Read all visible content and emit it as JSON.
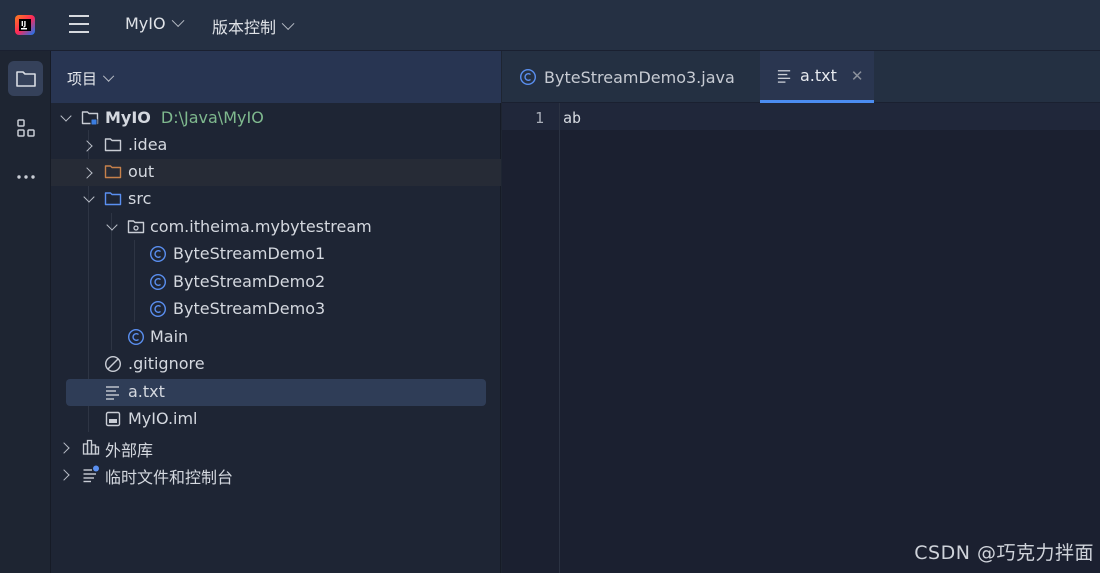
{
  "topbar": {
    "menus": [
      {
        "label": "MyIO"
      },
      {
        "label": "版本控制"
      }
    ]
  },
  "toolstrip": {
    "tools": [
      "folder-icon",
      "structure-icon",
      "more-icon"
    ]
  },
  "project_panel": {
    "title": "项目",
    "tree": [
      {
        "label": "MyIO",
        "hint": "D:\\Java\\MyIO",
        "icon": "module-folder-icon",
        "expanded": true
      },
      {
        "label": ".idea",
        "icon": "folder-icon",
        "expanded": false
      },
      {
        "label": "out",
        "icon": "folder-icon",
        "expanded": false,
        "color": "#c6814b"
      },
      {
        "label": "src",
        "icon": "source-folder-icon",
        "expanded": true,
        "color": "#5a8ff0"
      },
      {
        "label": "com.itheima.mybytestream",
        "icon": "package-icon",
        "expanded": true
      },
      {
        "label": "ByteStreamDemo1",
        "icon": "class-icon"
      },
      {
        "label": "ByteStreamDemo2",
        "icon": "class-icon"
      },
      {
        "label": "ByteStreamDemo3",
        "icon": "class-icon"
      },
      {
        "label": "Main",
        "icon": "class-icon"
      },
      {
        "label": ".gitignore",
        "icon": "ignore-file-icon"
      },
      {
        "label": "a.txt",
        "icon": "text-file-icon",
        "selected": true
      },
      {
        "label": "MyIO.iml",
        "icon": "iml-file-icon"
      },
      {
        "label": "外部库",
        "icon": "library-icon",
        "expanded": false
      },
      {
        "label": "临时文件和控制台",
        "icon": "scratch-icon",
        "expanded": false
      }
    ]
  },
  "editor": {
    "tabs": [
      {
        "label": "ByteStreamDemo3.java",
        "icon": "class-icon",
        "active": false
      },
      {
        "label": "a.txt",
        "icon": "text-file-icon",
        "active": true,
        "close": "✕"
      }
    ],
    "lines": [
      {
        "number": "1",
        "text": "ab"
      }
    ]
  },
  "watermark": "CSDN @巧克力拌面",
  "colors": {
    "accent": "#4b8cf0",
    "selection": "#2f3d57",
    "path_hint": "#7fb98e"
  }
}
